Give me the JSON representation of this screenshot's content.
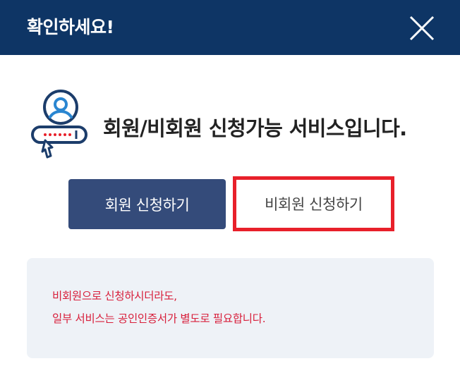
{
  "dialog": {
    "title": "확인하세요!",
    "close_icon": "close-icon",
    "header_color": "#0e3565"
  },
  "main": {
    "icon": "member-login-icon",
    "headline": "회원/비회원 신청가능 서비스입니다."
  },
  "buttons": {
    "member_label": "회원 신청하기",
    "guest_label": "비회원 신청하기",
    "member_color": "#344b7a",
    "guest_highlight_color": "#e8202a"
  },
  "notice": {
    "line1": "비회원으로 신청하시더라도,",
    "line2": "일부 서비스는 공인인증서가 별도로 필요합니다.",
    "text_color": "#d8203c"
  }
}
